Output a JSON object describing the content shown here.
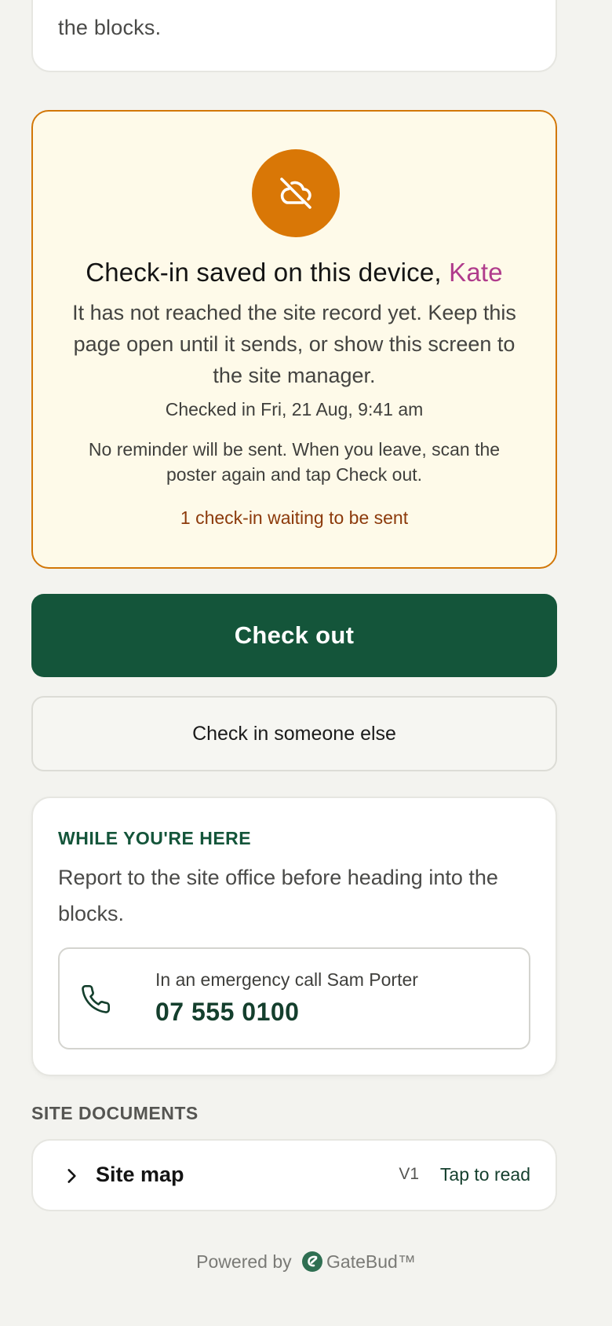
{
  "top_card": {
    "tail_text": "the blocks."
  },
  "notice": {
    "icon": "cloud-off-icon",
    "headline_prefix": "Check-in saved on this device, ",
    "name": "Kate",
    "body": "It has not reached the site record yet. Keep this page open until it sends, or show this screen to the site manager.",
    "checked_in": "Checked in Fri, 21 Aug, 9:41 am",
    "reminder": "No reminder will be sent. When you leave, scan the poster again and tap Check out.",
    "queue_status": "1 check-in waiting to be sent"
  },
  "actions": {
    "check_out_label": "Check out",
    "check_in_other_label": "Check in someone else"
  },
  "info": {
    "eyebrow": "WHILE YOU'RE HERE",
    "text": "Report to the site office before heading into the blocks.",
    "emergency_label": "In an emergency call Sam Porter",
    "emergency_number": "07 555 0100"
  },
  "documents": {
    "heading": "SITE DOCUMENTS",
    "items": [
      {
        "title": "Site map",
        "version": "V1",
        "action": "Tap to read"
      }
    ]
  },
  "footer": {
    "powered_by": "Powered by",
    "brand": "GateBud™"
  },
  "colors": {
    "brand_green": "#14553a",
    "warning_orange": "#d97706",
    "notice_bg": "#fefae9",
    "name_accent": "#b03c8c"
  }
}
